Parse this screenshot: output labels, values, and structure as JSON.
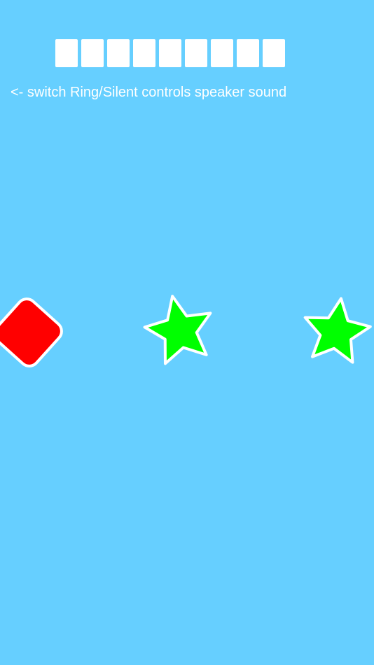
{
  "hint": {
    "text": "<- switch Ring/Silent controls speaker sound"
  },
  "score": {
    "box_count": 9
  },
  "shapes": [
    {
      "type": "rounded-square",
      "color": "#FF0000",
      "icon": "red-square"
    },
    {
      "type": "star",
      "color": "#00FF00",
      "icon": "green-star"
    },
    {
      "type": "star",
      "color": "#00FF00",
      "icon": "green-star"
    }
  ],
  "colors": {
    "background": "#66CFFF",
    "outline": "#FFFFFF"
  }
}
